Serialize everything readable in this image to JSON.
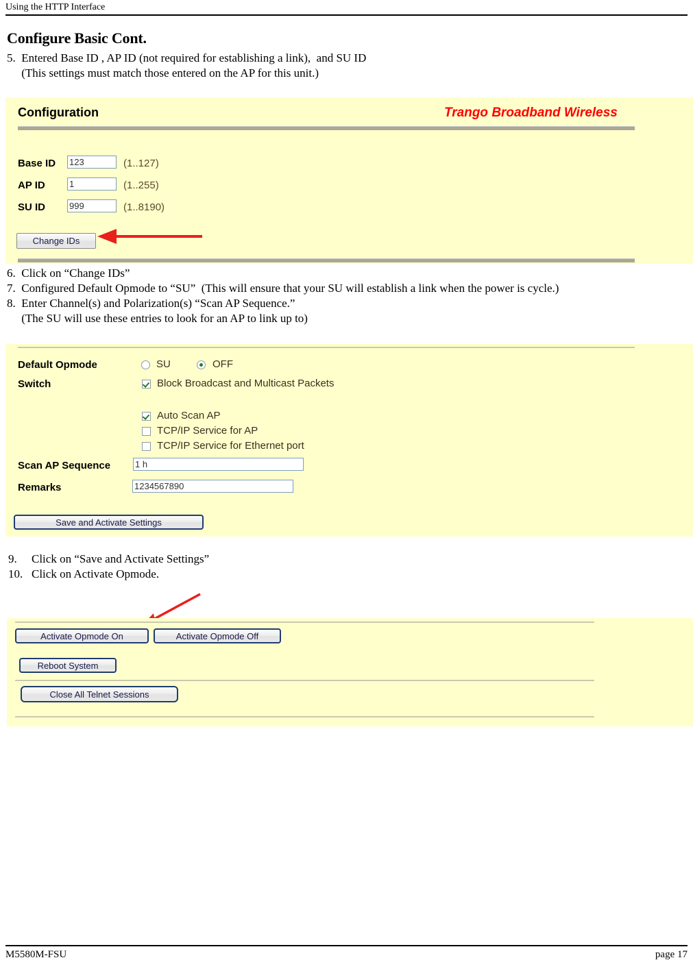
{
  "document": {
    "running_header": "Using the HTTP Interface",
    "footer_left": "M5580M-FSU",
    "footer_right": "page 17",
    "section_title": "Configure Basic Cont.",
    "steps_block_1": "5.  Entered Base ID , AP ID (not required for establishing a link),  and SU ID\n     (This settings must match those entered on the AP for this unit.)",
    "steps_block_2": "6.  Click on “Change IDs”\n7.  Configured Default Opmode to “SU”  (This will ensure that your SU will establish a link when the power is cycle.)\n8.  Enter Channel(s) and Polarization(s) “Scan AP Sequence.”\n     (The SU will use these entries to look for an AP to link up to)",
    "steps_block_3": "9.     Click on “Save and Activate Settings”\n10.   Click on Activate Opmode."
  },
  "colors": {
    "panel_background": "#FFFFCC",
    "brand_red": "#FF0000",
    "annotation_red": "#E8211A",
    "input_border": "#7F9DB9",
    "focus_border": "#1F3D6E",
    "divider_gray": "#A8A894",
    "option_text": "#3A3020"
  },
  "config_panel": {
    "title": "Configuration",
    "brand": "Trango Broadband Wireless",
    "fields": [
      {
        "label": "Base ID",
        "value": "123",
        "range": "(1..127)"
      },
      {
        "label": "AP ID",
        "value": "1",
        "range": "(1..255)"
      },
      {
        "label": "SU ID",
        "value": "999",
        "range": "(1..8190)"
      }
    ],
    "change_ids_button": "Change IDs"
  },
  "opmode_panel": {
    "default_opmode_label": "Default Opmode",
    "switch_label": "Switch",
    "opmode_options": [
      {
        "label": "SU",
        "selected": false
      },
      {
        "label": "OFF",
        "selected": true
      }
    ],
    "checkboxes": [
      {
        "label": "Block Broadcast and Multicast Packets",
        "checked": true
      },
      {
        "label": "Auto Scan AP",
        "checked": true
      },
      {
        "label": "TCP/IP Service for AP",
        "checked": false
      },
      {
        "label": "TCP/IP Service for Ethernet port",
        "checked": false
      }
    ],
    "scan_ap_sequence_label": "Scan AP Sequence",
    "scan_ap_sequence_value": "1 h",
    "remarks_label": "Remarks",
    "remarks_value": "1234567890",
    "save_button": "Save and Activate Settings"
  },
  "actions_panel": {
    "activate_on_button": "Activate Opmode On",
    "activate_off_button": "Activate Opmode Off",
    "reboot_button": "Reboot System",
    "close_telnet_button": "Close All Telnet Sessions"
  },
  "annotations": {
    "arrow_to_change_ids": "red-arrow-left",
    "arrow_to_activate_opmode_on": "red-arrow-diagonal"
  }
}
